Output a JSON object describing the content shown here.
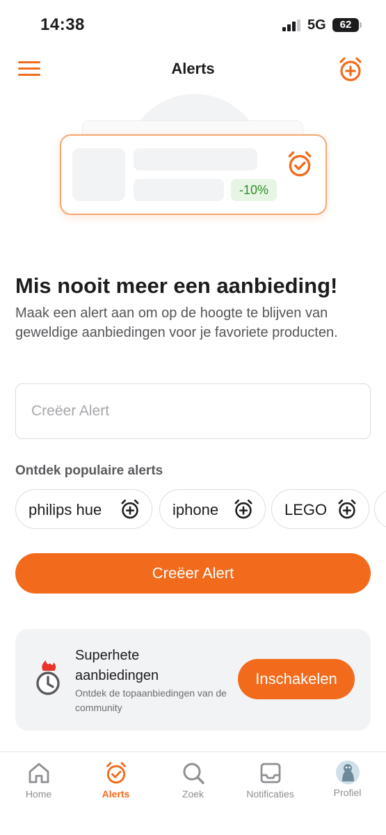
{
  "status_bar": {
    "time": "14:38",
    "network": "5G",
    "battery": "62"
  },
  "header": {
    "title": "Alerts",
    "menu_icon": "hamburger-menu-icon",
    "add_icon": "alarm-clock-plus-icon"
  },
  "illustration": {
    "discount": "-10%"
  },
  "main": {
    "headline": "Mis nooit meer een aanbieding!",
    "subtext": "Maak een alert aan om op de hoogte te blijven van geweldige aanbiedingen voor je favoriete producten.",
    "search_placeholder": "Creëer Alert",
    "popular_title": "Ontdek populaire alerts",
    "chips": [
      {
        "label": "philips hue"
      },
      {
        "label": "iphone"
      },
      {
        "label": "LEGO"
      }
    ],
    "cta_label": "Creëer Alert"
  },
  "promo": {
    "title": "Superhete aanbiedingen",
    "subtitle": "Ontdek de topaanbiedingen van de community",
    "button_label": "Inschakelen"
  },
  "tabs": [
    {
      "label": "Home",
      "icon": "home-icon",
      "active": false
    },
    {
      "label": "Alerts",
      "icon": "alarm-clock-icon",
      "active": true
    },
    {
      "label": "Zoek",
      "icon": "search-icon",
      "active": false
    },
    {
      "label": "Notificaties",
      "icon": "inbox-icon",
      "active": false
    },
    {
      "label": "Profiel",
      "icon": "avatar",
      "active": false
    }
  ],
  "colors": {
    "accent": "#f26a1b",
    "discount_text": "#2f8f2a",
    "discount_bg": "#e6f5e4"
  }
}
